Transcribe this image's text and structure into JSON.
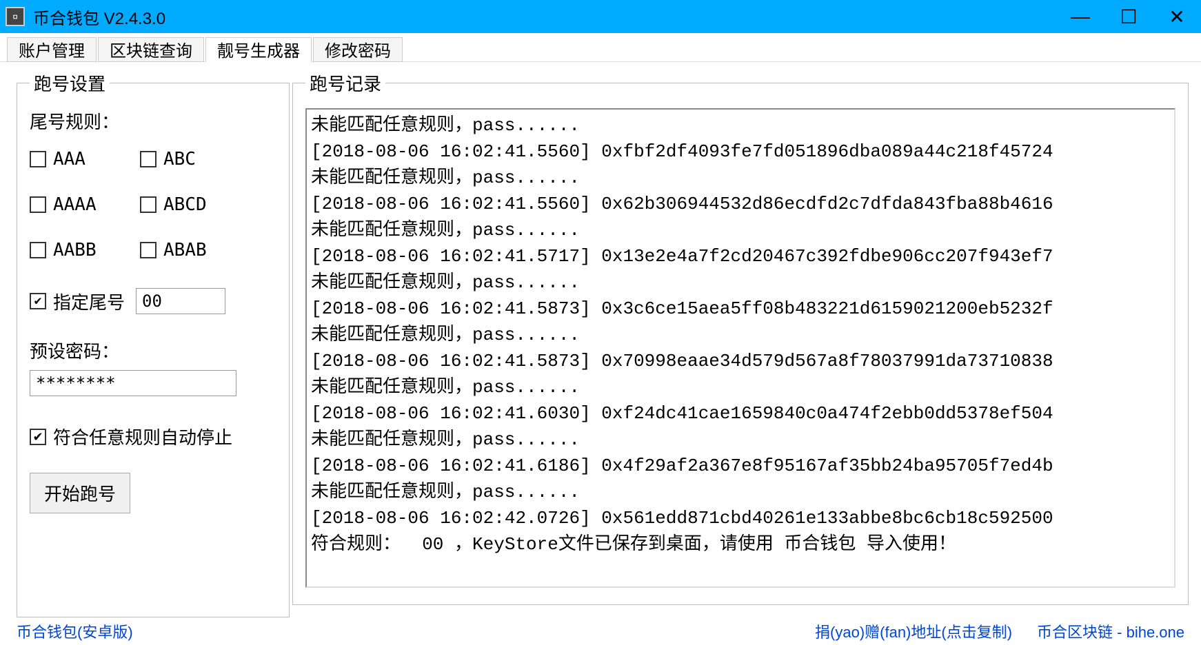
{
  "window": {
    "title": "币合钱包   V2.4.3.0"
  },
  "tabs": {
    "items": [
      "账户管理",
      "区块链查询",
      "靓号生成器",
      "修改密码"
    ],
    "active_index": 2
  },
  "left_panel": {
    "group_title": "跑号设置",
    "rule_label": "尾号规则：",
    "rules": [
      {
        "label": "AAA",
        "checked": false
      },
      {
        "label": "ABC",
        "checked": false
      },
      {
        "label": "AAAA",
        "checked": false
      },
      {
        "label": "ABCD",
        "checked": false
      },
      {
        "label": "AABB",
        "checked": false
      },
      {
        "label": "ABAB",
        "checked": false
      }
    ],
    "custom_suffix": {
      "label": "指定尾号",
      "checked": true,
      "value": "00"
    },
    "password": {
      "label": "预设密码：",
      "value": "********"
    },
    "auto_stop": {
      "label": "符合任意规则自动停止",
      "checked": true
    },
    "start_button": "开始跑号"
  },
  "right_panel": {
    "group_title": "跑号记录",
    "log_lines": [
      "未能匹配任意规则，pass......",
      "[2018-08-06 16:02:41.5560] 0xfbf2df4093fe7fd051896dba089a44c218f45724",
      "未能匹配任意规则，pass......",
      "[2018-08-06 16:02:41.5560] 0x62b306944532d86ecdfd2c7dfda843fba88b4616",
      "未能匹配任意规则，pass......",
      "[2018-08-06 16:02:41.5717] 0x13e2e4a7f2cd20467c392fdbe906cc207f943ef7",
      "未能匹配任意规则，pass......",
      "[2018-08-06 16:02:41.5873] 0x3c6ce15aea5ff08b483221d6159021200eb5232f",
      "未能匹配任意规则，pass......",
      "[2018-08-06 16:02:41.5873] 0x70998eaae34d579d567a8f78037991da73710838",
      "未能匹配任意规则，pass......",
      "[2018-08-06 16:02:41.6030] 0xf24dc41cae1659840c0a474f2ebb0dd5378ef504",
      "未能匹配任意规则，pass......",
      "[2018-08-06 16:02:41.6186] 0x4f29af2a367e8f95167af35bb24ba95705f7ed4b",
      "未能匹配任意规则，pass......",
      "[2018-08-06 16:02:42.0726] 0x561edd871cbd40261e133abbe8bc6cb18c592500",
      "符合规则：  00 ，KeyStore文件已保存到桌面，请使用 币合钱包 导入使用！"
    ]
  },
  "footer": {
    "left": "币合钱包(安卓版)",
    "mid": "捐(yao)赠(fan)地址(点击复制)",
    "right": "币合区块链 - bihe.one"
  }
}
